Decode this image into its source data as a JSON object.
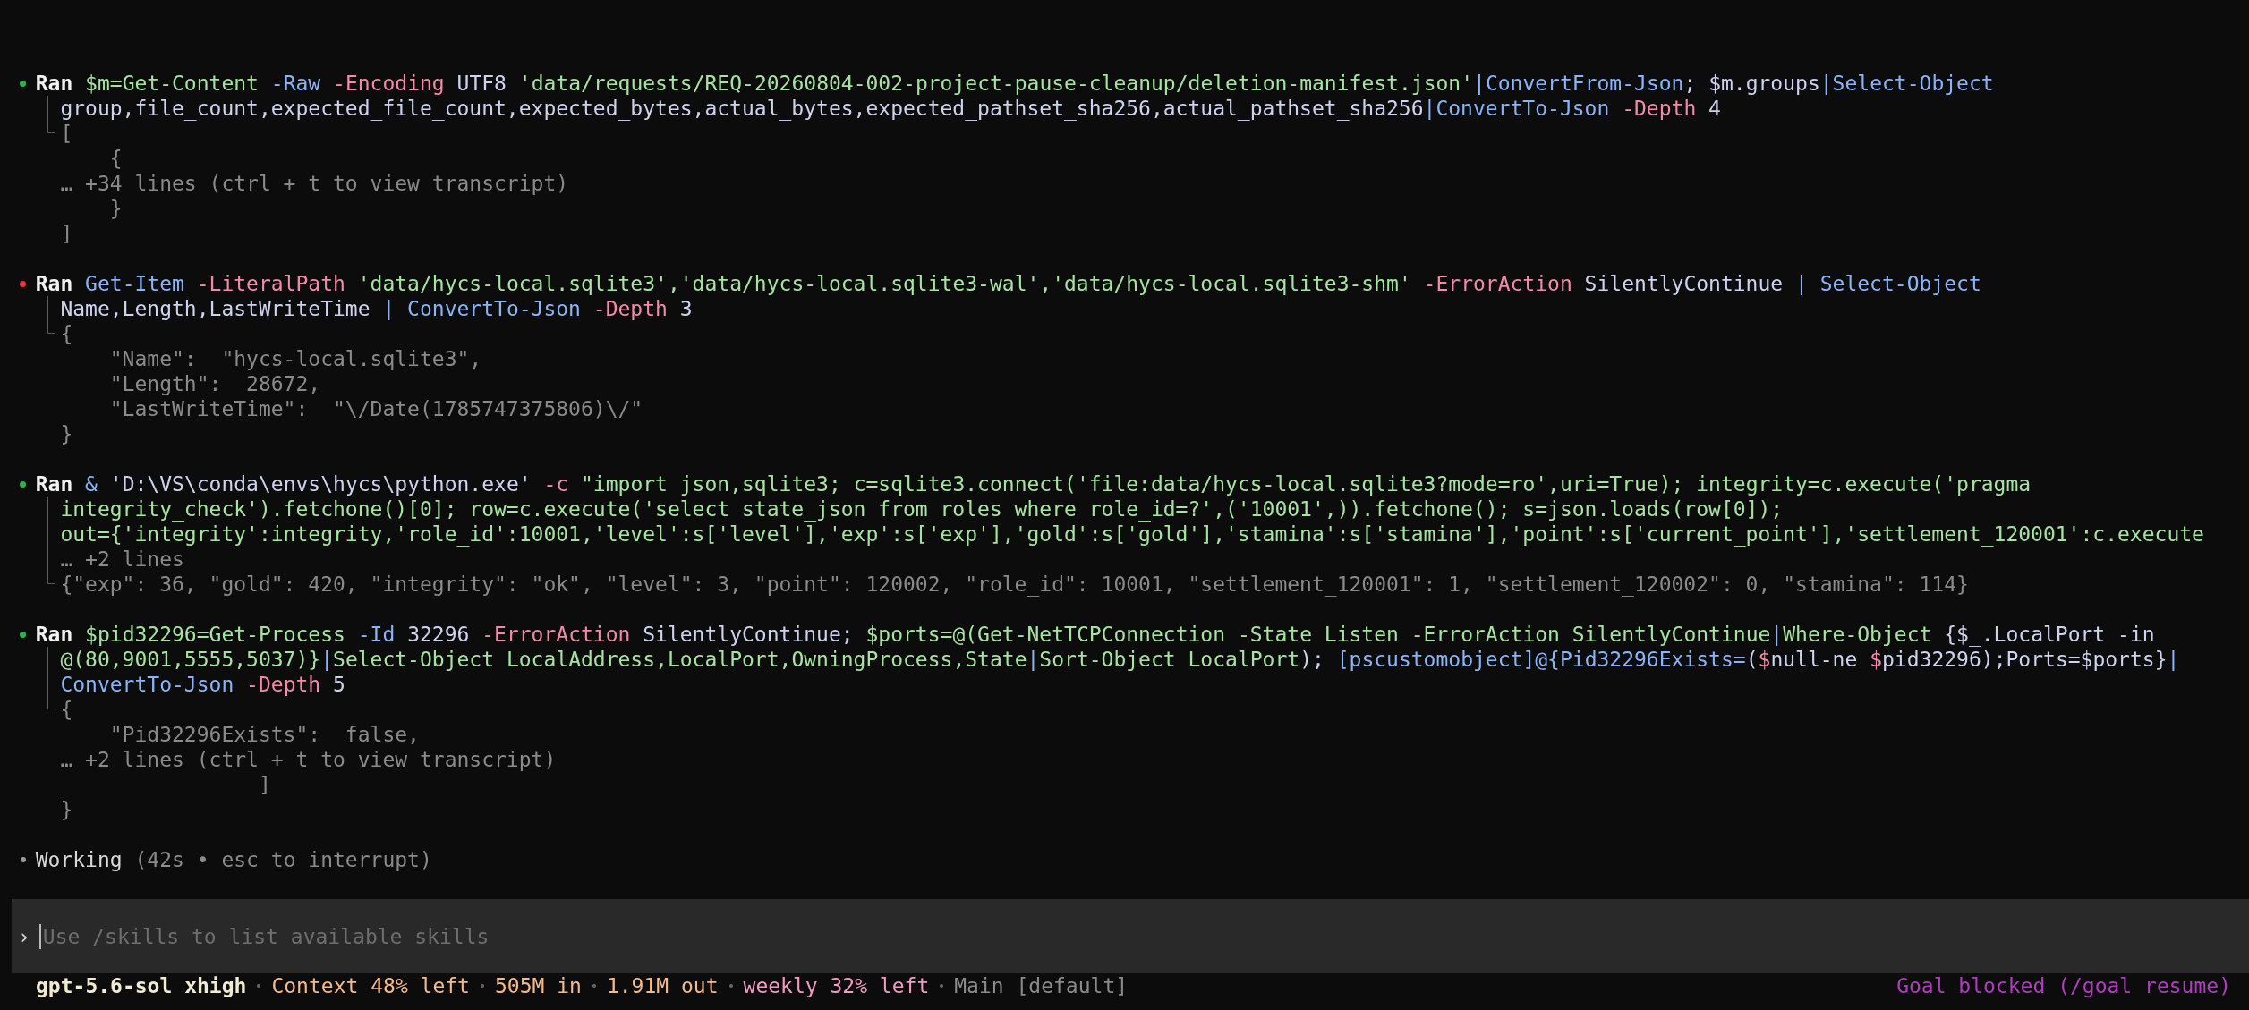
{
  "entries": [
    {
      "failed": false,
      "label": "Ran",
      "command_lines": [
        [
          {
            "kind": "string",
            "text": "$m=Get-Content "
          },
          {
            "kind": "command",
            "text": "-Raw "
          },
          {
            "kind": "parameter",
            "text": "-Encoding "
          },
          {
            "kind": "plain",
            "text": "UTF8 "
          },
          {
            "kind": "string",
            "text": "'data/requests/REQ-20260804-002-project-pause-cleanup/deletion-manifest.json'"
          },
          {
            "kind": "command",
            "text": "|ConvertFrom-Json"
          },
          {
            "kind": "plain",
            "text": "; $m.groups"
          },
          {
            "kind": "command",
            "text": "|Select-Object"
          }
        ],
        [
          {
            "kind": "plain",
            "text": "group,file_count,expected_file_count,expected_bytes,actual_bytes,expected_pathset_sha256,actual_pathset_sha256"
          },
          {
            "kind": "command",
            "text": "|ConvertTo-Json "
          },
          {
            "kind": "parameter",
            "text": "-Depth "
          },
          {
            "kind": "plain",
            "text": "4"
          }
        ]
      ],
      "output_lines": [
        "[",
        "    {",
        "… +34 lines (ctrl + t to view transcript)",
        "    }",
        "]"
      ]
    },
    {
      "failed": true,
      "label": "Ran",
      "command_lines": [
        [
          {
            "kind": "command",
            "text": "Get-Item "
          },
          {
            "kind": "parameter",
            "text": "-LiteralPath "
          },
          {
            "kind": "string",
            "text": "'data/hycs-local.sqlite3','data/hycs-local.sqlite3-wal','data/hycs-local.sqlite3-shm' "
          },
          {
            "kind": "parameter",
            "text": "-ErrorAction "
          },
          {
            "kind": "plain",
            "text": "SilentlyContinue "
          },
          {
            "kind": "command",
            "text": "| Select-Object"
          }
        ],
        [
          {
            "kind": "plain",
            "text": "Name,Length,LastWriteTime "
          },
          {
            "kind": "command",
            "text": "| ConvertTo-Json "
          },
          {
            "kind": "parameter",
            "text": "-Depth "
          },
          {
            "kind": "plain",
            "text": "3"
          }
        ]
      ],
      "output_lines": [
        "{",
        "    \"Name\":  \"hycs-local.sqlite3\",",
        "    \"Length\":  28672,",
        "    \"LastWriteTime\":  \"\\/Date(1785747375806)\\/\"",
        "}"
      ]
    },
    {
      "failed": false,
      "label": "Ran",
      "command_lines": [
        [
          {
            "kind": "command",
            "text": "& "
          },
          {
            "kind": "plain",
            "text": "'D:\\VS\\conda\\envs\\hycs\\python.exe' "
          },
          {
            "kind": "parameter",
            "text": "-c "
          },
          {
            "kind": "string",
            "text": "\"import json,sqlite3; c=sqlite3.connect('file:data/hycs-local.sqlite3?mode=ro',uri=True); integrity=c.execute('pragma"
          }
        ],
        [
          {
            "kind": "string",
            "text": "integrity_check').fetchone()[0]; row=c.execute('select state_json from roles where role_id=?',('10001',)).fetchone(); s=json.loads(row[0]);"
          }
        ],
        [
          {
            "kind": "string",
            "text": "out={'integrity':integrity,'role_id':10001,'level':s['level'],'exp':s['exp'],'gold':s['gold'],'stamina':s['stamina'],'point':s['current_point'],'settlement_120001':c.execute"
          }
        ],
        [
          {
            "kind": "dim",
            "text": "… +2 lines"
          }
        ]
      ],
      "output_lines": [
        "{\"exp\": 36, \"gold\": 420, \"integrity\": \"ok\", \"level\": 3, \"point\": 120002, \"role_id\": 10001, \"settlement_120001\": 1, \"settlement_120002\": 0, \"stamina\": 114}"
      ]
    },
    {
      "failed": false,
      "label": "Ran",
      "command_lines": [
        [
          {
            "kind": "string",
            "text": "$pid32296=Get-Process "
          },
          {
            "kind": "command",
            "text": "-Id "
          },
          {
            "kind": "plain",
            "text": "32296 "
          },
          {
            "kind": "parameter",
            "text": "-ErrorAction "
          },
          {
            "kind": "plain",
            "text": "SilentlyContinue; "
          },
          {
            "kind": "string",
            "text": "$ports=@(Get-NetTCPConnection -State Listen -ErrorAction SilentlyContinue"
          },
          {
            "kind": "command",
            "text": "|"
          },
          {
            "kind": "string",
            "text": "Where-Object "
          },
          {
            "kind": "plain",
            "text": "{$_.LocalPort -in"
          }
        ],
        [
          {
            "kind": "string",
            "text": "@(80,9001,5555,5037)}"
          },
          {
            "kind": "command",
            "text": "|"
          },
          {
            "kind": "string",
            "text": "Select-Object LocalAddress,LocalPort,OwningProcess,State"
          },
          {
            "kind": "command",
            "text": "|"
          },
          {
            "kind": "string",
            "text": "Sort-Object LocalPort"
          },
          {
            "kind": "plain",
            "text": "); "
          },
          {
            "kind": "command",
            "text": "[pscustomobject]@{Pid32296Exists="
          },
          {
            "kind": "plain",
            "text": "("
          },
          {
            "kind": "parameter",
            "text": "$"
          },
          {
            "kind": "plain",
            "text": "null-ne "
          },
          {
            "kind": "parameter",
            "text": "$"
          },
          {
            "kind": "plain",
            "text": "pid32296);Ports=$ports}"
          },
          {
            "kind": "command",
            "text": "|"
          }
        ],
        [
          {
            "kind": "command",
            "text": "ConvertTo-Json "
          },
          {
            "kind": "parameter",
            "text": "-Depth "
          },
          {
            "kind": "plain",
            "text": "5"
          }
        ]
      ],
      "output_lines": [
        "{",
        "    \"Pid32296Exists\":  false,",
        "… +2 lines (ctrl + t to view transcript)",
        "                ]",
        "}"
      ]
    }
  ],
  "working": {
    "label": "Working",
    "detail": "(42s • esc to interrupt)"
  },
  "composer": {
    "prompt": "›",
    "placeholder": "Use /skills to list available skills"
  },
  "status_bar": {
    "items": [
      {
        "kind": "model",
        "text": "gpt-5.6-sol xhigh"
      },
      {
        "kind": "usage",
        "text": "Context 48% left"
      },
      {
        "kind": "usage",
        "text": "505M in"
      },
      {
        "kind": "usage",
        "text": "1.91M out"
      },
      {
        "kind": "quota",
        "text": "weekly 32% left"
      },
      {
        "kind": "branch",
        "text": "Main [default]"
      }
    ],
    "goal": "Goal blocked (/goal resume)"
  }
}
